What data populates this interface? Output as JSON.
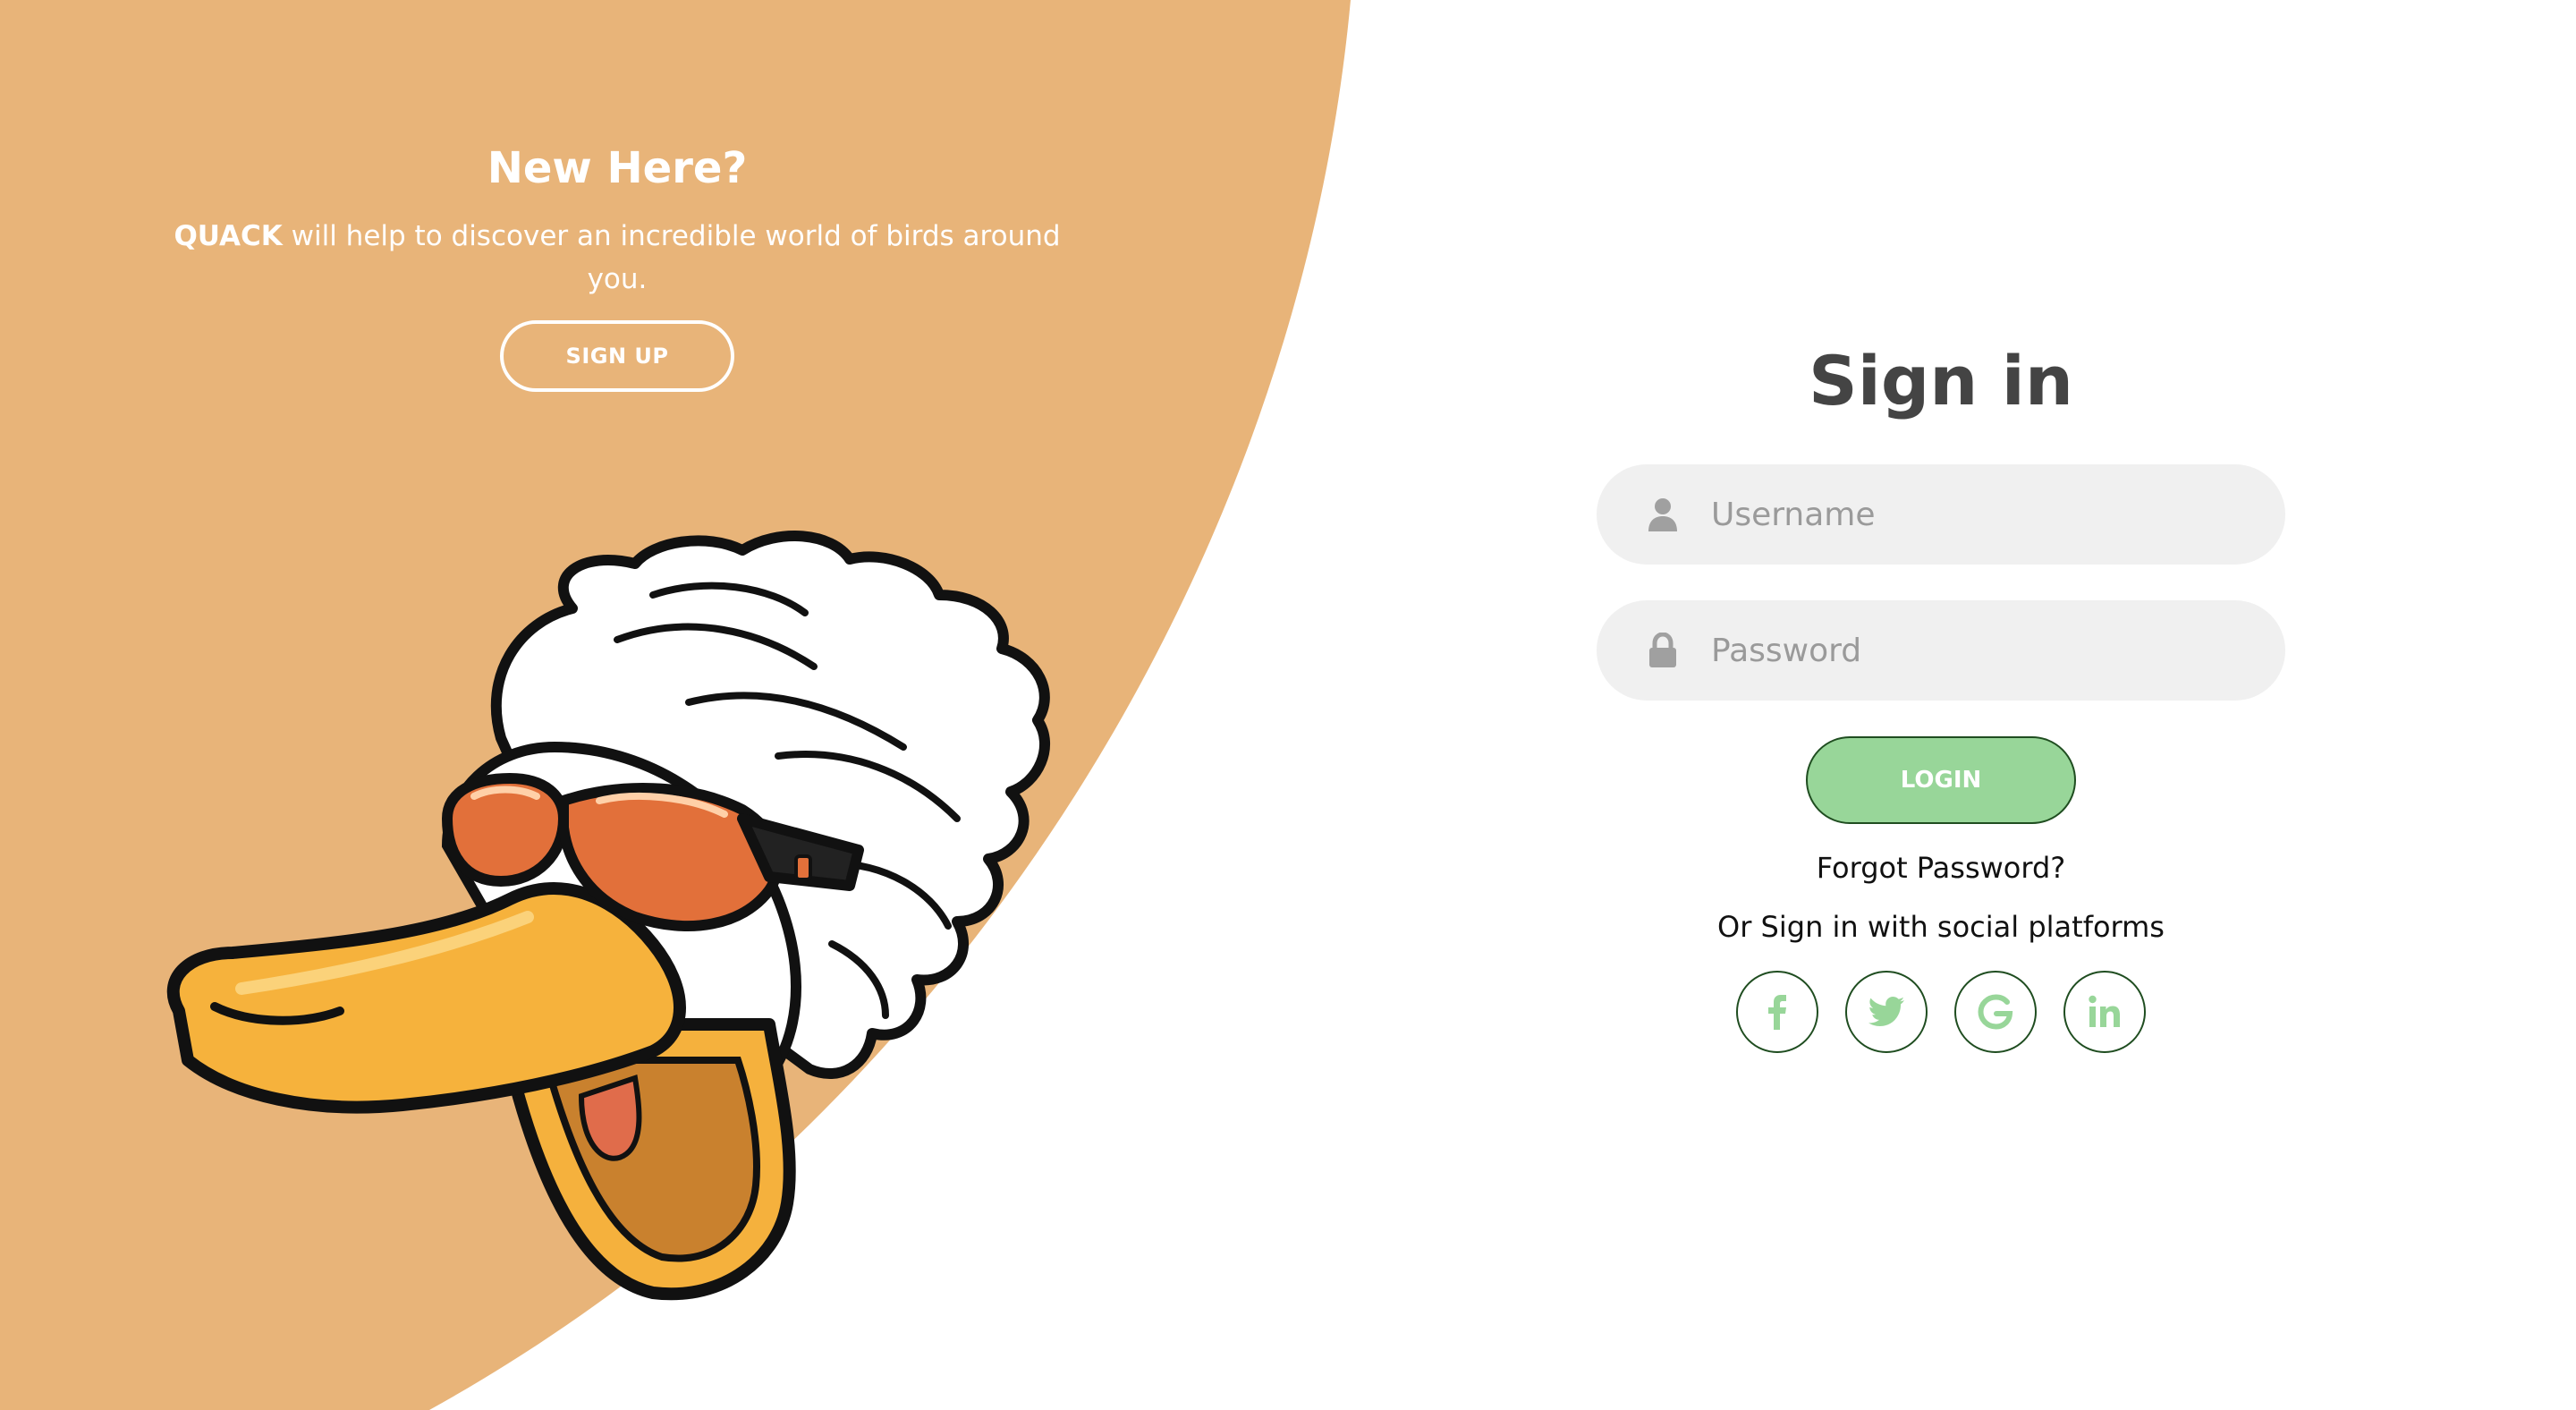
{
  "colors": {
    "panel_bg": "#e8b479",
    "accent_green": "#98d699",
    "dark_green_border": "#1f4d20",
    "input_bg": "#f0f0f0",
    "title_gray": "#444444"
  },
  "left_panel": {
    "title": "New Here?",
    "brand": "QUACK",
    "description": " will help to discover an incredible world of birds around you.",
    "signup_label": "SIGN UP",
    "illustration": "duck-mascot-with-sunglasses"
  },
  "signin": {
    "title": "Sign in",
    "username_placeholder": "Username",
    "password_placeholder": "Password",
    "username_icon": "user-icon",
    "password_icon": "lock-icon",
    "login_label": "LOGIN",
    "forgot_label": "Forgot Password?",
    "social_text": "Or Sign in with social platforms",
    "social": [
      {
        "name": "facebook",
        "icon": "facebook-icon"
      },
      {
        "name": "twitter",
        "icon": "twitter-icon"
      },
      {
        "name": "google",
        "icon": "google-icon"
      },
      {
        "name": "linkedin",
        "icon": "linkedin-icon"
      }
    ]
  }
}
